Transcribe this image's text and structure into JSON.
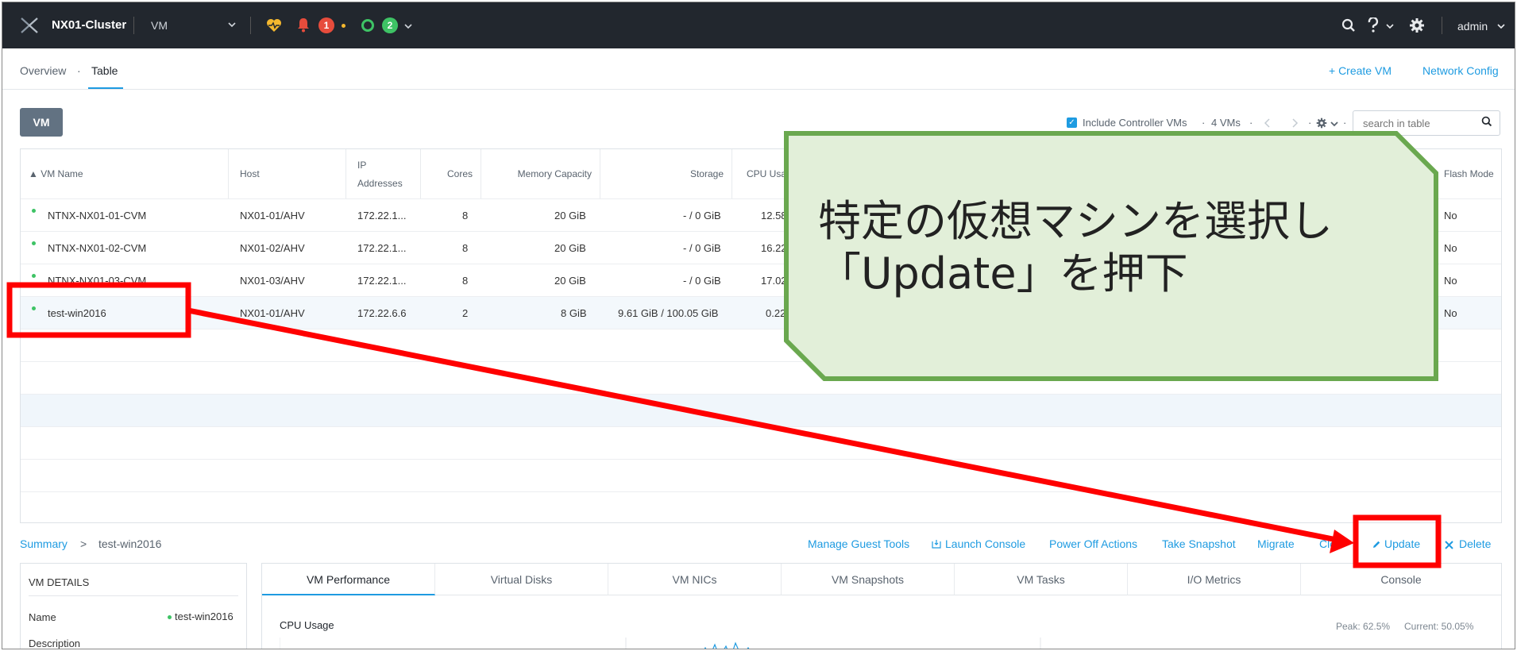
{
  "topbar": {
    "cluster_name": "NX01-Cluster",
    "view_selector": "VM",
    "alert_count": "1",
    "task_count": "2",
    "user": "admin",
    "icons": [
      "nutanix-logo-icon",
      "health-heart-icon",
      "bell-icon",
      "circle-status-icon",
      "search-icon",
      "help-icon",
      "gear-icon",
      "chevron-down-icon"
    ]
  },
  "subnav": {
    "tabs": [
      {
        "label": "Overview"
      },
      {
        "label": "Table"
      }
    ],
    "separator": "·",
    "active_tab": "Table",
    "create_vm": "+ Create VM",
    "network_config": "Network Config"
  },
  "toolbar": {
    "vm_button": "VM",
    "include_cvms": "Include Controller VMs",
    "vm_count": "4 VMs",
    "dot": "·",
    "search_placeholder": "search in table"
  },
  "table": {
    "columns": [
      {
        "label": "▲  VM Name"
      },
      {
        "label": "Host"
      },
      {
        "label": "IP"
      },
      {
        "label": "Addresses"
      },
      {
        "label": "Cores"
      },
      {
        "label": "Memory Capacity"
      },
      {
        "label": "Storage"
      },
      {
        "label": "CPU Usa"
      },
      {
        "label": "Flash Mode"
      }
    ],
    "rows": [
      {
        "name": "NTNX-NX01-01-CVM",
        "host": "NX01-01/AHV",
        "ip": "172.22.1...",
        "cores": "8",
        "memory": "20 GiB",
        "storage": "- / 0 GiB",
        "cpu": "12.58",
        "flash": "No"
      },
      {
        "name": "NTNX-NX01-02-CVM",
        "host": "NX01-02/AHV",
        "ip": "172.22.1...",
        "cores": "8",
        "memory": "20 GiB",
        "storage": "- / 0 GiB",
        "cpu": "16.22",
        "flash": "No"
      },
      {
        "name": "NTNX-NX01-03-CVM",
        "host": "NX01-03/AHV",
        "ip": "172.22.1...",
        "cores": "8",
        "memory": "20 GiB",
        "storage": "- / 0 GiB",
        "cpu": "17.02",
        "flash": "No"
      },
      {
        "name": "test-win2016",
        "host": "NX01-01/AHV",
        "ip": "172.22.6.6",
        "cores": "2",
        "memory": "8 GiB",
        "storage": "9.61 GiB / 100.05 GiB",
        "cpu": "0.22",
        "flash": "No"
      }
    ]
  },
  "summary": {
    "link": "Summary",
    "chevron": ">",
    "vm_name": "test-win2016",
    "actions": [
      {
        "label": "Manage Guest Tools"
      },
      {
        "label": "Launch Console"
      },
      {
        "label": "Power Off Actions"
      },
      {
        "label": "Take Snapshot"
      },
      {
        "label": "Migrate"
      },
      {
        "label": "Clo"
      },
      {
        "label": "Update"
      },
      {
        "label": "Delete"
      }
    ]
  },
  "details": {
    "heading": "VM DETAILS",
    "name_label": "Name",
    "name_value": "test-win2016",
    "description_label": "Description"
  },
  "performance": {
    "tabs": [
      {
        "label": "VM Performance"
      },
      {
        "label": "Virtual Disks"
      },
      {
        "label": "VM NICs"
      },
      {
        "label": "VM Snapshots"
      },
      {
        "label": "VM Tasks"
      },
      {
        "label": "I/O Metrics"
      },
      {
        "label": "Console"
      }
    ],
    "chart_title": "CPU Usage",
    "peak": "Peak: 62.5%",
    "current": "Current: 50.05%"
  },
  "annotation": {
    "text": "特定の仮想マシンを選択し\n「Update」を押下",
    "callout_fill": "#e2efd9",
    "callout_border": "#6aa84f",
    "highlight_color": "#ff0000"
  },
  "colors": {
    "topbar_bg": "#22272e",
    "accent": "#1e9be1",
    "status_green": "#3ec365",
    "alert_red": "#e74c3c"
  }
}
